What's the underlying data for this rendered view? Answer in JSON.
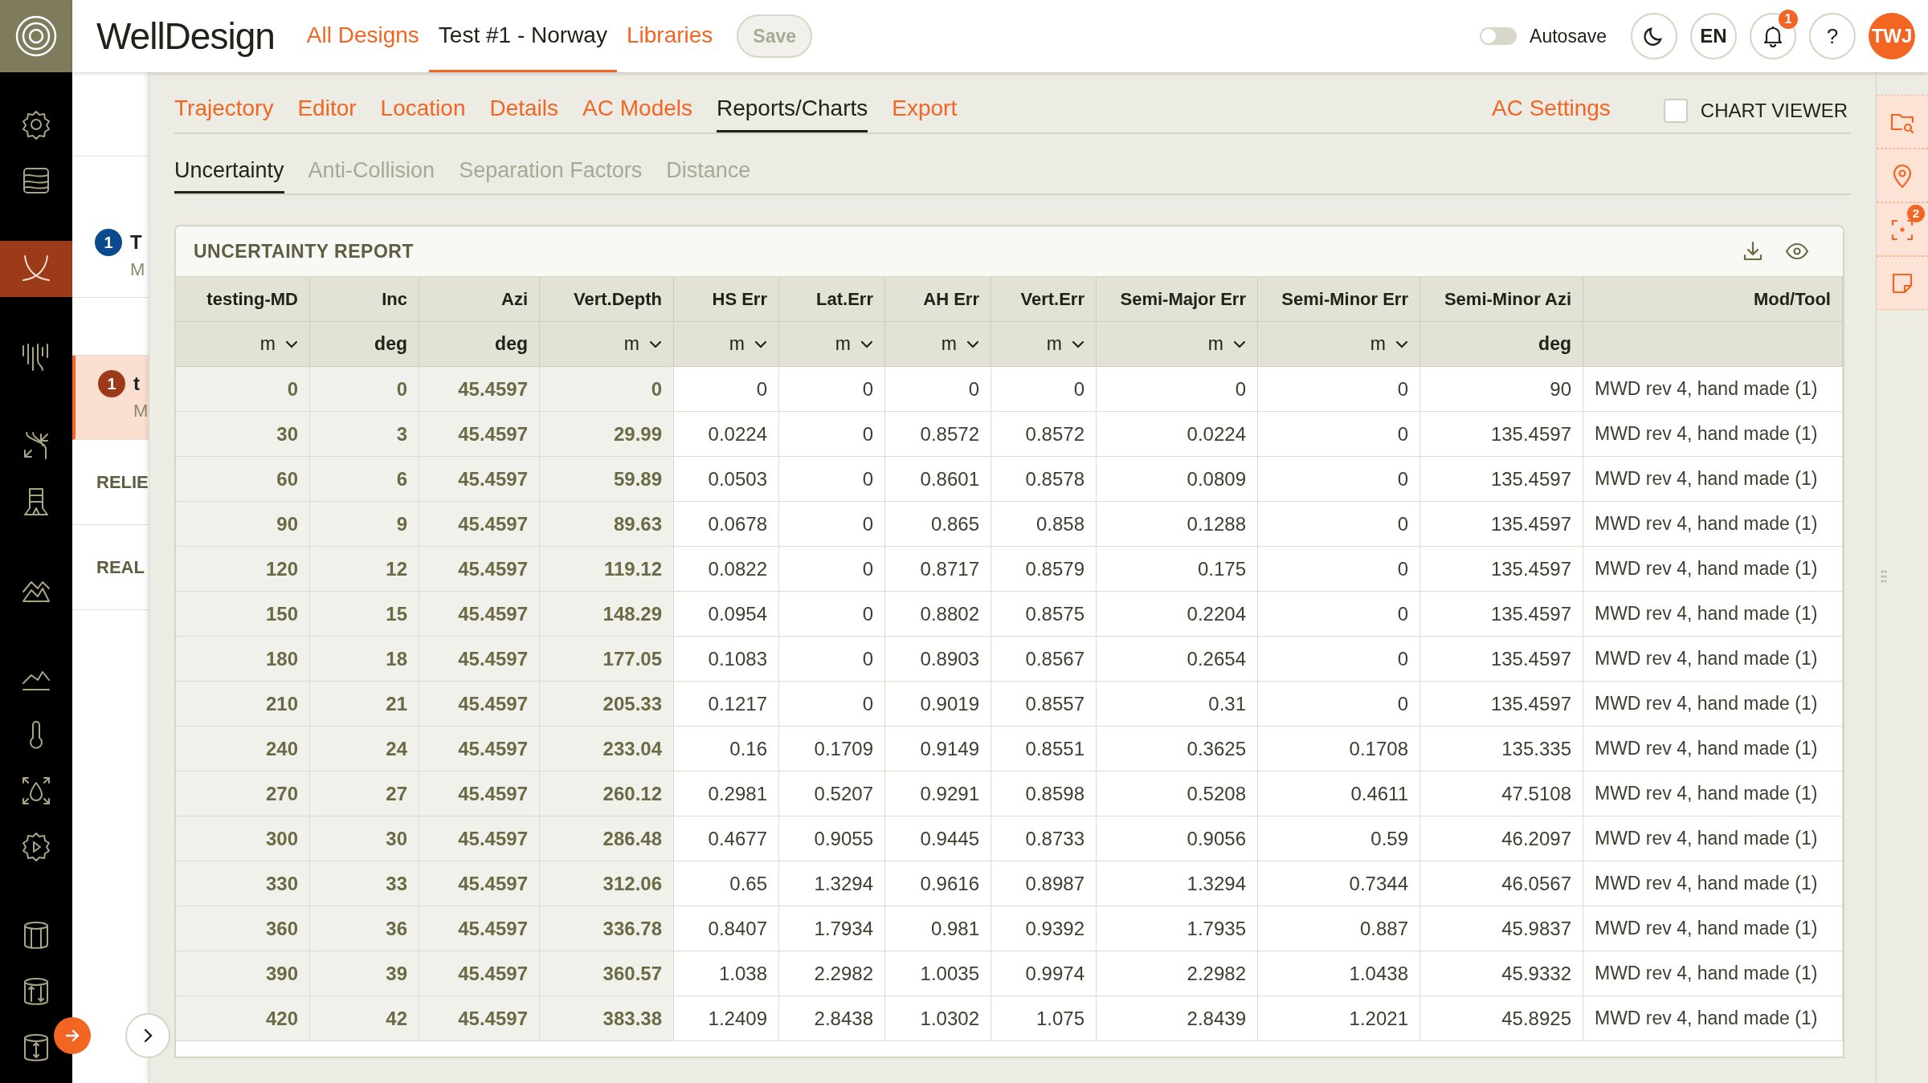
{
  "app": {
    "logo_text": "WellDesign"
  },
  "top_nav": [
    {
      "label": "All Designs",
      "selected": false
    },
    {
      "label": "Test #1 - Norway",
      "selected": true
    },
    {
      "label": "Libraries",
      "selected": false
    }
  ],
  "save_button": {
    "label": "Save",
    "disabled": true
  },
  "autosave": {
    "label": "Autosave",
    "on": false
  },
  "header_buttons": [
    {
      "kind": "theme"
    },
    {
      "kind": "language",
      "label": "EN"
    },
    {
      "kind": "notifications",
      "badge": "1"
    },
    {
      "kind": "help",
      "label": "?"
    }
  ],
  "avatar": {
    "initials": "TWJ"
  },
  "sidebar_icons": [
    {
      "kind": "settings",
      "selected": false
    },
    {
      "kind": "layers",
      "selected": false
    },
    {
      "kind": "trajectory",
      "selected": true
    },
    {
      "kind": "wells",
      "selected": false
    },
    {
      "kind": "paths",
      "selected": false
    },
    {
      "kind": "rig",
      "selected": false
    },
    {
      "kind": "terrain",
      "selected": false
    },
    {
      "kind": "profile",
      "selected": false
    },
    {
      "kind": "temperature",
      "selected": false
    },
    {
      "kind": "fluid",
      "selected": false
    },
    {
      "kind": "process",
      "selected": false
    },
    {
      "kind": "cylinder",
      "selected": false
    },
    {
      "kind": "cylinder-arrows",
      "selected": false
    },
    {
      "kind": "cylinder-updown",
      "selected": false
    }
  ],
  "left_panel": [
    {
      "kind": "design",
      "badge": "1",
      "color": "#0b4a8f",
      "title": "T",
      "subtitle": "M",
      "selected": false
    },
    {
      "kind": "design",
      "badge": "1",
      "color": "#9c3a1a",
      "title": "t",
      "subtitle": "M",
      "selected": true
    },
    {
      "kind": "section",
      "title": "RELIE"
    },
    {
      "kind": "section",
      "title": "REAL"
    }
  ],
  "tabs": [
    {
      "label": "Trajectory",
      "selected": false
    },
    {
      "label": "Editor",
      "selected": false
    },
    {
      "label": "Location",
      "selected": false
    },
    {
      "label": "Details",
      "selected": false
    },
    {
      "label": "AC Models",
      "selected": false
    },
    {
      "label": "Reports/Charts",
      "selected": true
    },
    {
      "label": "Export",
      "selected": false
    }
  ],
  "ac_settings": "AC Settings",
  "chart_viewer": {
    "label": "CHART VIEWER",
    "checked": false
  },
  "sub_tabs": [
    {
      "label": "Uncertainty",
      "selected": true
    },
    {
      "label": "Anti-Collision",
      "selected": false
    },
    {
      "label": "Separation Factors",
      "selected": false
    },
    {
      "label": "Distance",
      "selected": false
    }
  ],
  "report": {
    "title": "UNCERTAINTY REPORT",
    "columns": [
      {
        "name": "testing-MD",
        "unit": "m",
        "dropdown": true,
        "kind": "key"
      },
      {
        "name": "Inc",
        "unit": "deg",
        "dropdown": false,
        "kind": "key"
      },
      {
        "name": "Azi",
        "unit": "deg",
        "dropdown": false,
        "kind": "key"
      },
      {
        "name": "Vert.Depth",
        "unit": "m",
        "dropdown": true,
        "kind": "key"
      },
      {
        "name": "HS Err",
        "unit": "m",
        "dropdown": true,
        "kind": "value"
      },
      {
        "name": "Lat.Err",
        "unit": "m",
        "dropdown": true,
        "kind": "value"
      },
      {
        "name": "AH Err",
        "unit": "m",
        "dropdown": true,
        "kind": "value"
      },
      {
        "name": "Vert.Err",
        "unit": "m",
        "dropdown": true,
        "kind": "value"
      },
      {
        "name": "Semi-Major Err",
        "unit": "m",
        "dropdown": true,
        "kind": "value"
      },
      {
        "name": "Semi-Minor Err",
        "unit": "m",
        "dropdown": true,
        "kind": "value"
      },
      {
        "name": "Semi-Minor Azi",
        "unit": "deg",
        "dropdown": false,
        "kind": "value"
      },
      {
        "name": "Mod/Tool",
        "kind": "value"
      }
    ],
    "rows": [
      [
        "0",
        "0",
        "45.4597",
        "0",
        "0",
        "0",
        "0",
        "0",
        "0",
        "0",
        "90",
        "MWD rev 4, hand made (1)"
      ],
      [
        "30",
        "3",
        "45.4597",
        "29.99",
        "0.0224",
        "0",
        "0.8572",
        "0.8572",
        "0.0224",
        "0",
        "135.4597",
        "MWD rev 4, hand made (1)"
      ],
      [
        "60",
        "6",
        "45.4597",
        "59.89",
        "0.0503",
        "0",
        "0.8601",
        "0.8578",
        "0.0809",
        "0",
        "135.4597",
        "MWD rev 4, hand made (1)"
      ],
      [
        "90",
        "9",
        "45.4597",
        "89.63",
        "0.0678",
        "0",
        "0.865",
        "0.858",
        "0.1288",
        "0",
        "135.4597",
        "MWD rev 4, hand made (1)"
      ],
      [
        "120",
        "12",
        "45.4597",
        "119.12",
        "0.0822",
        "0",
        "0.8717",
        "0.8579",
        "0.175",
        "0",
        "135.4597",
        "MWD rev 4, hand made (1)"
      ],
      [
        "150",
        "15",
        "45.4597",
        "148.29",
        "0.0954",
        "0",
        "0.8802",
        "0.8575",
        "0.2204",
        "0",
        "135.4597",
        "MWD rev 4, hand made (1)"
      ],
      [
        "180",
        "18",
        "45.4597",
        "177.05",
        "0.1083",
        "0",
        "0.8903",
        "0.8567",
        "0.2654",
        "0",
        "135.4597",
        "MWD rev 4, hand made (1)"
      ],
      [
        "210",
        "21",
        "45.4597",
        "205.33",
        "0.1217",
        "0",
        "0.9019",
        "0.8557",
        "0.31",
        "0",
        "135.4597",
        "MWD rev 4, hand made (1)"
      ],
      [
        "240",
        "24",
        "45.4597",
        "233.04",
        "0.16",
        "0.1709",
        "0.9149",
        "0.8551",
        "0.3625",
        "0.1708",
        "135.335",
        "MWD rev 4, hand made (1)"
      ],
      [
        "270",
        "27",
        "45.4597",
        "260.12",
        "0.2981",
        "0.5207",
        "0.9291",
        "0.8598",
        "0.5208",
        "0.4611",
        "47.5108",
        "MWD rev 4, hand made (1)"
      ],
      [
        "300",
        "30",
        "45.4597",
        "286.48",
        "0.4677",
        "0.9055",
        "0.9445",
        "0.8733",
        "0.9056",
        "0.59",
        "46.2097",
        "MWD rev 4, hand made (1)"
      ],
      [
        "330",
        "33",
        "45.4597",
        "312.06",
        "0.65",
        "1.3294",
        "0.9616",
        "0.8987",
        "1.3294",
        "0.7344",
        "46.0567",
        "MWD rev 4, hand made (1)"
      ],
      [
        "360",
        "36",
        "45.4597",
        "336.78",
        "0.8407",
        "1.7934",
        "0.981",
        "0.9392",
        "1.7935",
        "0.887",
        "45.9837",
        "MWD rev 4, hand made (1)"
      ],
      [
        "390",
        "39",
        "45.4597",
        "360.57",
        "1.038",
        "2.2982",
        "1.0035",
        "0.9974",
        "2.2982",
        "1.0438",
        "45.9332",
        "MWD rev 4, hand made (1)"
      ],
      [
        "420",
        "42",
        "45.4597",
        "383.38",
        "1.2409",
        "2.8438",
        "1.0302",
        "1.075",
        "2.8439",
        "1.2021",
        "45.8925",
        "MWD rev 4, hand made (1)"
      ]
    ]
  },
  "right_rail": [
    {
      "kind": "folder-search"
    },
    {
      "kind": "location"
    },
    {
      "kind": "focus",
      "badge": "2"
    },
    {
      "kind": "note"
    }
  ]
}
